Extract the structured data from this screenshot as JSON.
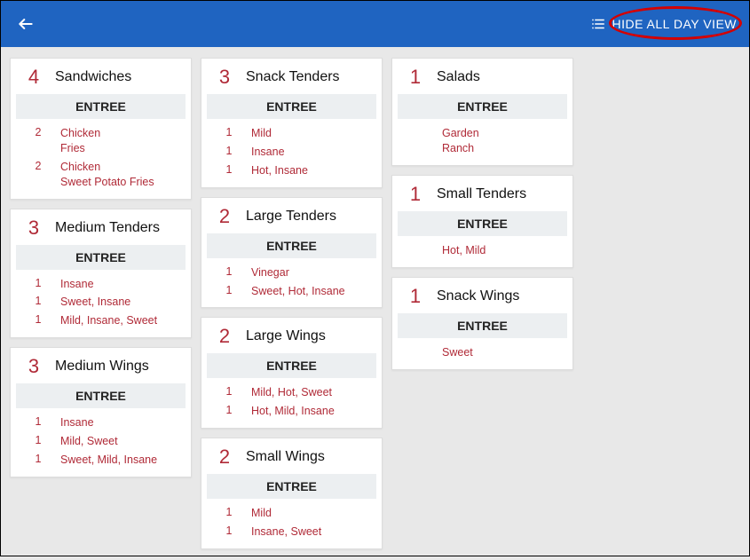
{
  "header": {
    "hide_label": "HIDE ALL DAY VIEW"
  },
  "section_label": "ENTREE",
  "columns": [
    [
      {
        "count": "4",
        "title": "Sandwiches",
        "items": [
          {
            "qty": "2",
            "name": "Chicken\nFries"
          },
          {
            "qty": "2",
            "name": "Chicken\nSweet Potato Fries"
          }
        ]
      },
      {
        "count": "3",
        "title": "Medium Tenders",
        "items": [
          {
            "qty": "1",
            "name": "Insane"
          },
          {
            "qty": "1",
            "name": "Sweet, Insane"
          },
          {
            "qty": "1",
            "name": "Mild, Insane, Sweet"
          }
        ]
      },
      {
        "count": "3",
        "title": "Medium Wings",
        "items": [
          {
            "qty": "1",
            "name": "Insane"
          },
          {
            "qty": "1",
            "name": "Mild, Sweet"
          },
          {
            "qty": "1",
            "name": "Sweet, Mild, Insane"
          }
        ]
      }
    ],
    [
      {
        "count": "3",
        "title": "Snack Tenders",
        "items": [
          {
            "qty": "1",
            "name": "Mild"
          },
          {
            "qty": "1",
            "name": "Insane"
          },
          {
            "qty": "1",
            "name": "Hot, Insane"
          }
        ]
      },
      {
        "count": "2",
        "title": "Large Tenders",
        "items": [
          {
            "qty": "1",
            "name": "Vinegar"
          },
          {
            "qty": "1",
            "name": "Sweet, Hot, Insane"
          }
        ]
      },
      {
        "count": "2",
        "title": "Large Wings",
        "items": [
          {
            "qty": "1",
            "name": "Mild, Hot, Sweet"
          },
          {
            "qty": "1",
            "name": "Hot, Mild, Insane"
          }
        ]
      },
      {
        "count": "2",
        "title": "Small Wings",
        "items": [
          {
            "qty": "1",
            "name": "Mild"
          },
          {
            "qty": "1",
            "name": "Insane, Sweet"
          }
        ]
      }
    ],
    [
      {
        "count": "1",
        "title": "Salads",
        "items": [
          {
            "qty": "",
            "name": "Garden\nRanch"
          }
        ]
      },
      {
        "count": "1",
        "title": "Small Tenders",
        "items": [
          {
            "qty": "",
            "name": "Hot, Mild"
          }
        ]
      },
      {
        "count": "1",
        "title": "Snack Wings",
        "items": [
          {
            "qty": "",
            "name": "Sweet"
          }
        ]
      }
    ]
  ]
}
